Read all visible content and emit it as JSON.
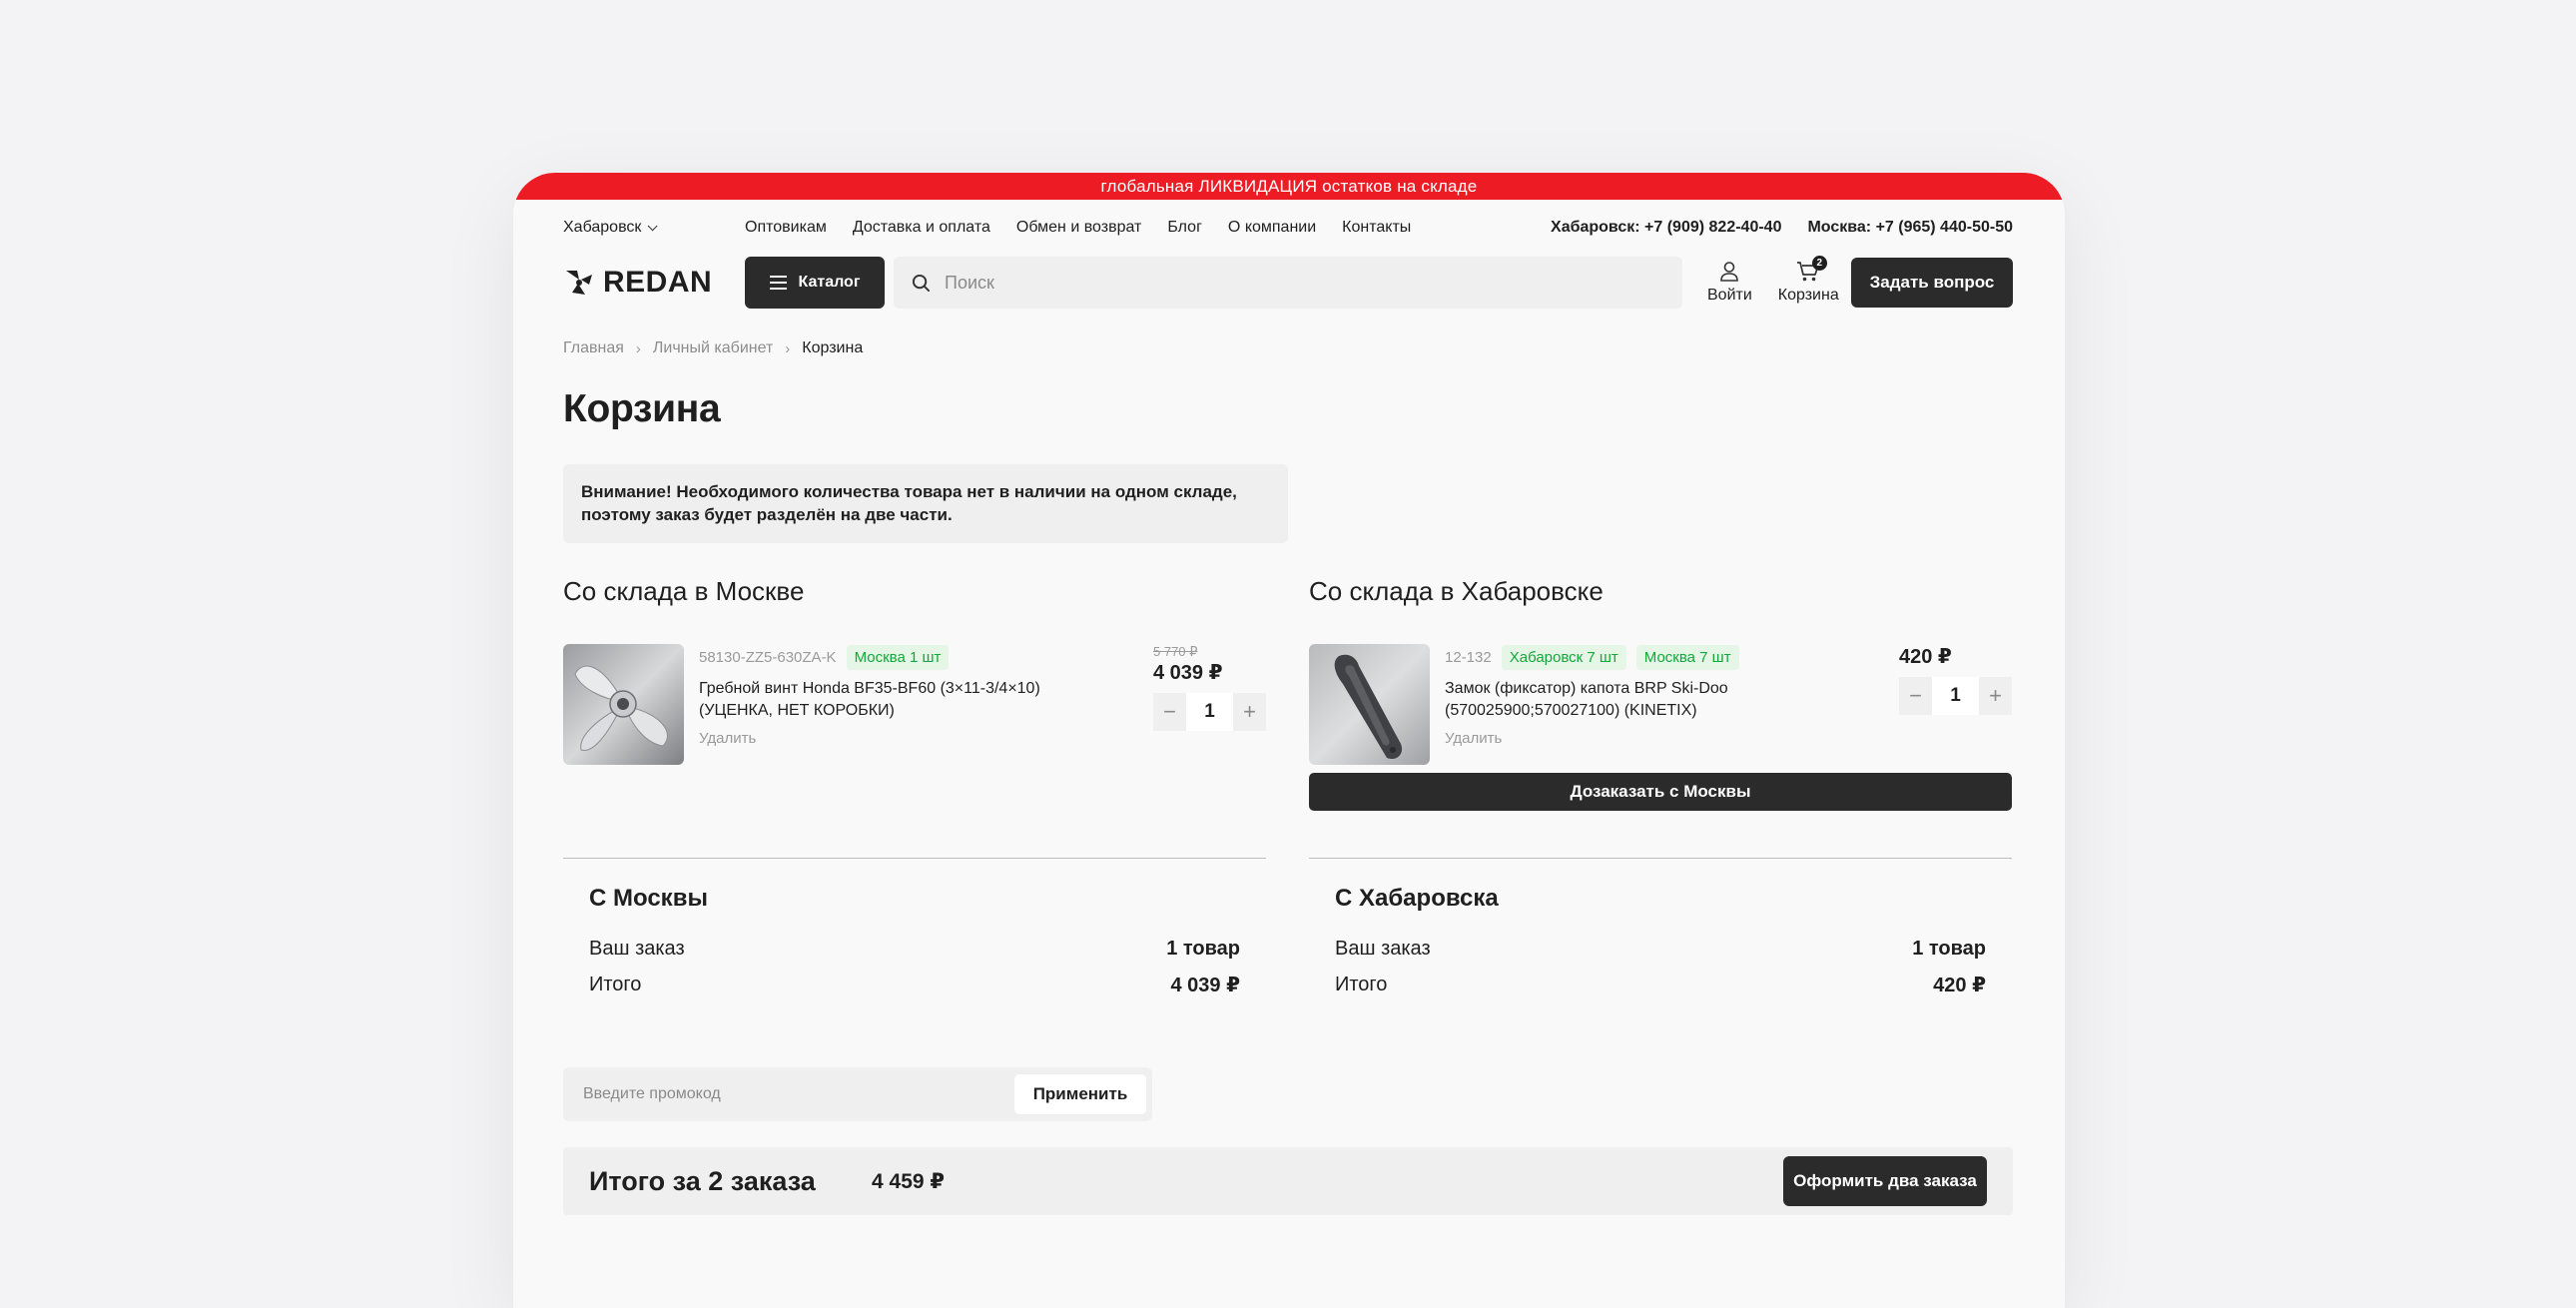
{
  "colors": {
    "accent": "#ed1c24",
    "dark": "#2b2b2b",
    "stock_green": "#14a83b"
  },
  "promo_banner": "глобальная ЛИКВИДАЦИЯ остатков на складе",
  "topnav": {
    "city": "Хабаровск",
    "links": [
      "Оптовикам",
      "Доставка и оплата",
      "Обмен и возврат",
      "Блог",
      "О компании",
      "Контакты"
    ],
    "phones": [
      "Хабаровск: +7 (909) 822-40-40",
      "Москва: +7 (965) 440-50-50"
    ]
  },
  "header": {
    "logo_text": "REDAN",
    "catalog_label": "Каталог",
    "search_placeholder": "Поиск",
    "login_label": "Войти",
    "cart_label": "Корзина",
    "cart_count": "2",
    "ask_label": "Задать вопрос"
  },
  "breadcrumbs": [
    "Главная",
    "Личный кабинет",
    "Корзина"
  ],
  "page_title": "Корзина",
  "alert_text": "Внимание! Необходимого количества товара нет в наличии на одном складе, поэтому заказ будет разделён на две части.",
  "warehouses": [
    {
      "title": "Со склада в Москве",
      "item": {
        "sku": "58130-ZZ5-630ZA-K",
        "stock": [
          "Москва 1 шт"
        ],
        "name": "Гребной винт Honda BF35-BF60 (3×11-3/4×10) (УЦЕНКА, НЕТ КОРОБКИ)",
        "remove": "Удалить",
        "old_price": "5 770 ₽",
        "price": "4 039 ₽",
        "qty": "1"
      },
      "summary": {
        "title": "С Москвы",
        "order_label": "Ваш заказ",
        "order_value": "1 товар",
        "total_label": "Итого",
        "total_value": "4 039 ₽"
      }
    },
    {
      "title": "Со склада в Хабаровске",
      "item": {
        "sku": "12-132",
        "stock": [
          "Хабаровск 7 шт",
          "Москва 7 шт"
        ],
        "name": "Замок (фиксатор) капота BRP Ski-Doo (570025900;570027100) (KINETIX)",
        "remove": "Удалить",
        "price": "420 ₽",
        "qty": "1"
      },
      "reorder_label": "Дозаказать с Москвы",
      "summary": {
        "title": "С Хабаровска",
        "order_label": "Ваш заказ",
        "order_value": "1 товар",
        "total_label": "Итого",
        "total_value": "420 ₽"
      }
    }
  ],
  "promo_code": {
    "placeholder": "Введите промокод",
    "apply_label": "Применить"
  },
  "total": {
    "label": "Итого за 2 заказа",
    "value": "4 459 ₽",
    "checkout_label": "Оформить два заказа"
  },
  "stepper": {
    "minus": "−",
    "plus": "+"
  }
}
